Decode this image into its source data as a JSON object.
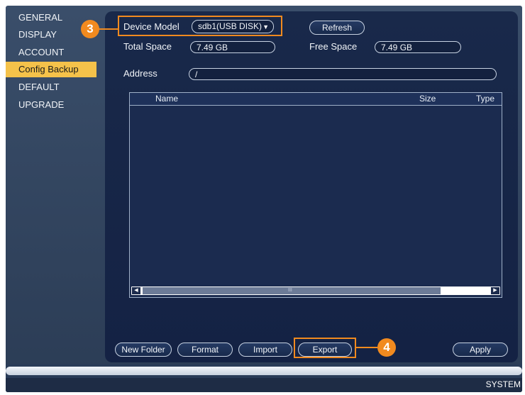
{
  "sidebar": {
    "items": [
      {
        "label": "GENERAL"
      },
      {
        "label": "DISPLAY"
      },
      {
        "label": "ACCOUNT"
      },
      {
        "label": "Config Backup",
        "active": true
      },
      {
        "label": "DEFAULT"
      },
      {
        "label": "UPGRADE"
      }
    ]
  },
  "device": {
    "model_label": "Device Model",
    "model_value": "sdb1(USB DISK)",
    "refresh_label": "Refresh",
    "total_space_label": "Total Space",
    "total_space_value": "7.49 GB",
    "free_space_label": "Free Space",
    "free_space_value": "7.49 GB",
    "address_label": "Address",
    "address_value": "/"
  },
  "table": {
    "columns": [
      "Name",
      "Size",
      "Type"
    ],
    "rows": [],
    "scroll_grip": "III"
  },
  "actions": {
    "new_folder": "New Folder",
    "format": "Format",
    "import": "Import",
    "export": "Export",
    "apply": "Apply"
  },
  "callouts": {
    "step_model": "3",
    "step_export": "4"
  },
  "footer": {
    "label": "SYSTEM"
  },
  "colors": {
    "accent": "#f5c24a",
    "callout": "#f18a1f",
    "panel": "#19294a",
    "background": "#33476a"
  },
  "icons": {
    "dropdown": "caret-down-icon",
    "scroll_left": "arrow-left-icon",
    "scroll_right": "arrow-right-icon"
  }
}
